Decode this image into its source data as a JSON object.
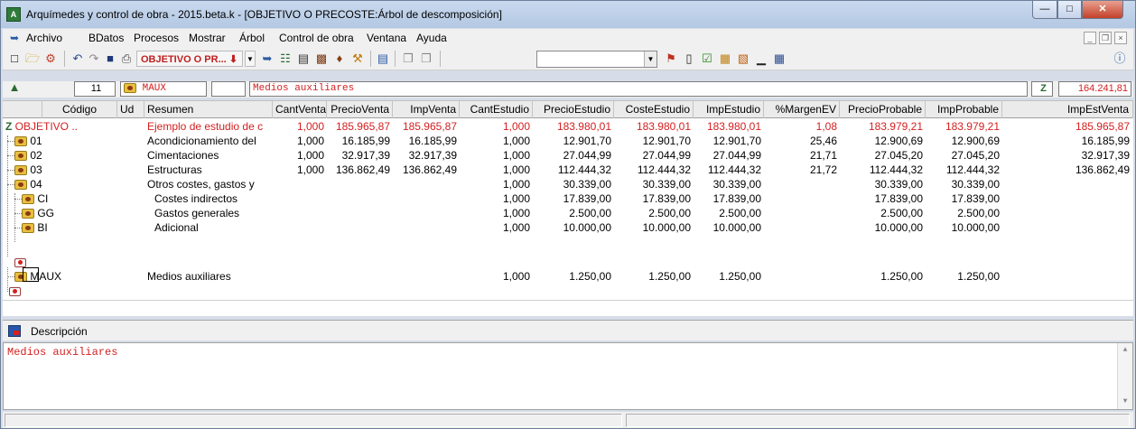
{
  "window": {
    "title": "Arquímedes y control de obra - 2015.beta.k - [OBJETIVO O PRECOSTE:Árbol de descomposición]",
    "app_icon": "arquimedes-app-icon"
  },
  "menubar": {
    "items": [
      "Archivo",
      "BDatos",
      "Procesos",
      "Mostrar",
      "Árbol",
      "Control de obra",
      "Ventana",
      "Ayuda"
    ]
  },
  "toolbar": {
    "objective_combo": "OBJETIVO O PR...",
    "blank_combo": ""
  },
  "record": {
    "level": "11",
    "code": "MAUX",
    "unit": "",
    "summary": "Medios auxiliares",
    "total": "164.241,81"
  },
  "grid": {
    "columns": [
      "Código",
      "Ud",
      "Resumen",
      "CantVenta",
      "PrecioVenta",
      "ImpVenta",
      "CantEstudio",
      "PrecioEstudio",
      "CosteEstudio",
      "ImpEstudio",
      "%MargenEV",
      "PrecioProbable",
      "ImpProbable",
      "ImpEstVenta"
    ],
    "rows": [
      {
        "code": "OBJETIVO ..",
        "ud": "",
        "resumen": "Ejemplo de estudio de c",
        "cantventa": "1,000",
        "precioventa": "185.965,87",
        "impventa": "185.965,87",
        "cantestudio": "1,000",
        "precioestudio": "183.980,01",
        "costeestudio": "183.980,01",
        "impestudio": "183.980,01",
        "margen": "1,08",
        "precioprobable": "183.979,21",
        "impprobable": "183.979,21",
        "impestventa": "185.965,87"
      },
      {
        "code": "01",
        "ud": "",
        "resumen": "Acondicionamiento del",
        "cantventa": "1,000",
        "precioventa": "16.185,99",
        "impventa": "16.185,99",
        "cantestudio": "1,000",
        "precioestudio": "12.901,70",
        "costeestudio": "12.901,70",
        "impestudio": "12.901,70",
        "margen": "25,46",
        "precioprobable": "12.900,69",
        "impprobable": "12.900,69",
        "impestventa": "16.185,99"
      },
      {
        "code": "02",
        "ud": "",
        "resumen": "Cimentaciones",
        "cantventa": "1,000",
        "precioventa": "32.917,39",
        "impventa": "32.917,39",
        "cantestudio": "1,000",
        "precioestudio": "27.044,99",
        "costeestudio": "27.044,99",
        "impestudio": "27.044,99",
        "margen": "21,71",
        "precioprobable": "27.045,20",
        "impprobable": "27.045,20",
        "impestventa": "32.917,39"
      },
      {
        "code": "03",
        "ud": "",
        "resumen": "Estructuras",
        "cantventa": "1,000",
        "precioventa": "136.862,49",
        "impventa": "136.862,49",
        "cantestudio": "1,000",
        "precioestudio": "112.444,32",
        "costeestudio": "112.444,32",
        "impestudio": "112.444,32",
        "margen": "21,72",
        "precioprobable": "112.444,32",
        "impprobable": "112.444,32",
        "impestventa": "136.862,49"
      },
      {
        "code": "04",
        "ud": "",
        "resumen": "Otros costes, gastos y",
        "cantventa": "",
        "precioventa": "",
        "impventa": "",
        "cantestudio": "1,000",
        "precioestudio": "30.339,00",
        "costeestudio": "30.339,00",
        "impestudio": "30.339,00",
        "margen": "",
        "precioprobable": "30.339,00",
        "impprobable": "30.339,00",
        "impestventa": ""
      },
      {
        "code": "CI",
        "ud": "",
        "resumen": "Costes indirectos",
        "cantventa": "",
        "precioventa": "",
        "impventa": "",
        "cantestudio": "1,000",
        "precioestudio": "17.839,00",
        "costeestudio": "17.839,00",
        "impestudio": "17.839,00",
        "margen": "",
        "precioprobable": "17.839,00",
        "impprobable": "17.839,00",
        "impestventa": ""
      },
      {
        "code": "GG",
        "ud": "",
        "resumen": "Gastos generales",
        "cantventa": "",
        "precioventa": "",
        "impventa": "",
        "cantestudio": "1,000",
        "precioestudio": "2.500,00",
        "costeestudio": "2.500,00",
        "impestudio": "2.500,00",
        "margen": "",
        "precioprobable": "2.500,00",
        "impprobable": "2.500,00",
        "impestventa": ""
      },
      {
        "code": "BI",
        "ud": "",
        "resumen": "Adicional",
        "cantventa": "",
        "precioventa": "",
        "impventa": "",
        "cantestudio": "1,000",
        "precioestudio": "10.000,00",
        "costeestudio": "10.000,00",
        "impestudio": "10.000,00",
        "margen": "",
        "precioprobable": "10.000,00",
        "impprobable": "10.000,00",
        "impestventa": ""
      },
      {
        "code": "MAUX",
        "ud": "",
        "resumen": "Medios auxiliares",
        "cantventa": "",
        "precioventa": "",
        "impventa": "",
        "cantestudio": "1,000",
        "precioestudio": "1.250,00",
        "costeestudio": "1.250,00",
        "impestudio": "1.250,00",
        "margen": "",
        "precioprobable": "1.250,00",
        "impprobable": "1.250,00",
        "impestventa": ""
      }
    ]
  },
  "description": {
    "label": "Descripción",
    "text": "Medios auxiliares"
  },
  "colors": {
    "root_text": "#d42020",
    "folder_fill": "#e8c040",
    "title_bar": "#c9d9ee"
  }
}
